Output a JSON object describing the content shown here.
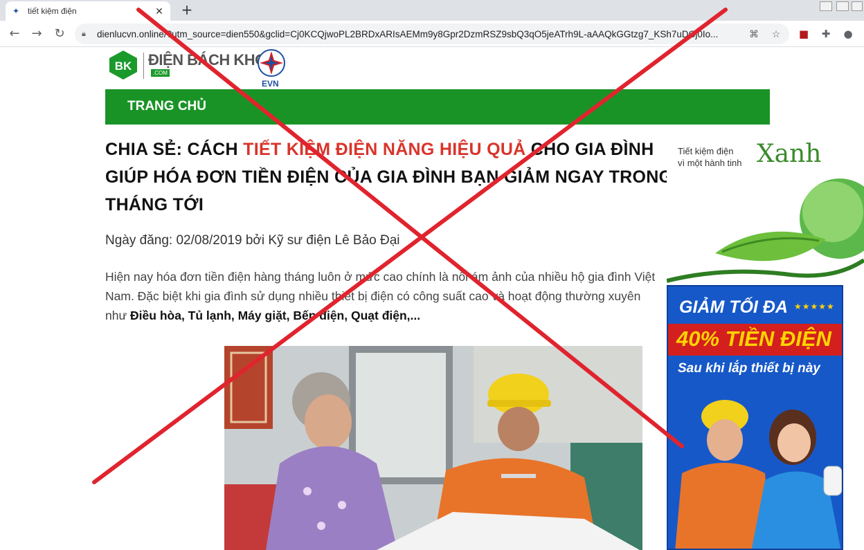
{
  "browser": {
    "tab_title": "tiết kiệm điện",
    "url": "dienlucvn.online/?utm_source=dien550&gclid=Cj0KCQjwoPL2BRDxARIsAEMm9y8Gpr2DzmRSZ9sbQ3qO5jeATrh9L-aAAQkGGtzg7_KSh7uDCj0Io...",
    "new_tab_label": "+",
    "close_label": "✕"
  },
  "site": {
    "logo_mark": "BK",
    "logo_name": "ĐIỆN BÁCH KHOA",
    "logo_suffix": ".COM",
    "partner_logo": "EVN",
    "nav_home": "TRANG CHỦ"
  },
  "article": {
    "headline_prefix": "CHIA SẺ: CÁCH ",
    "headline_highlight": "TIẾT KIỆM ĐIỆN NĂNG HIỆU QUẢ",
    "headline_suffix": " CHO GIA ĐÌNH GIÚP HÓA ĐƠN TIỀN ĐIỆN CỦA GIA ĐÌNH BẠN GIẢM NGAY TRONG THÁNG TỚI",
    "byline": "Ngày đăng: 02/08/2019 bởi Kỹ sư điện Lê Bảo Đại",
    "intro": "Hiện nay hóa đơn tiền điện hàng tháng luôn ở mức cao chính là nỗi ám ảnh của nhiều hộ gia đình Việt Nam. Đặc biệt khi gia đình sử dụng nhiều thiết bị điện có công suất cao và hoạt động thường xuyên như ",
    "intro_bold": "Điều hòa, Tủ lạnh, Máy giặt, Bếp điện, Quạt điện,...",
    "photo_alt": "woman and electrician reviewing bill"
  },
  "ads": {
    "green_line1": "Tiết kiệm điện",
    "green_line2": "vì một hành tinh",
    "green_word": "Xanh",
    "blue_title": "GIẢM TỐI ĐA",
    "blue_stars": "★★★★★",
    "blue_highlight": "40% TIỀN ĐIỆN",
    "blue_sub": "Sau khi lắp thiết bị này"
  },
  "colors": {
    "nav_green": "#1a9326",
    "headline_red": "#d9342b",
    "cross_red": "#e0242e",
    "ad_blue": "#1658c8"
  }
}
